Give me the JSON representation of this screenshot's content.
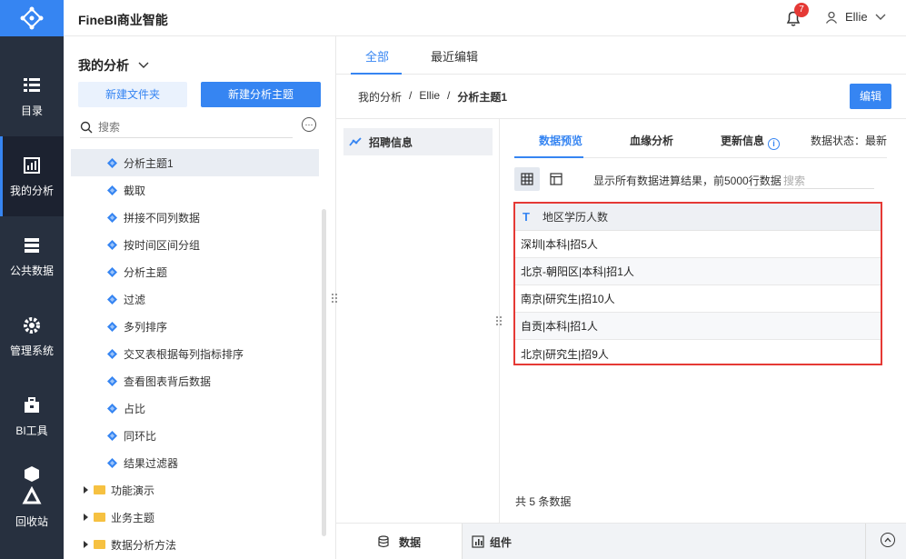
{
  "app": {
    "title": "FineBI商业智能"
  },
  "header": {
    "notification_count": "7",
    "user_name": "Ellie"
  },
  "nav": {
    "items": [
      {
        "label": "目录",
        "icon": "catalog-icon"
      },
      {
        "label": "我的分析",
        "icon": "analysis-icon",
        "active": true
      },
      {
        "label": "公共数据",
        "icon": "database-icon"
      },
      {
        "label": "管理系统",
        "icon": "gear-icon"
      },
      {
        "label": "BI工具",
        "icon": "toolbox-icon"
      },
      {
        "label": "回收站",
        "icon": "recycle-icon"
      }
    ]
  },
  "sidebar": {
    "title": "我的分析",
    "new_folder": "新建文件夹",
    "new_subject": "新建分析主题",
    "search_placeholder": "搜索",
    "items": [
      {
        "label": "分析主题1",
        "active": true
      },
      {
        "label": "截取"
      },
      {
        "label": "拼接不同列数据"
      },
      {
        "label": "按时间区间分组"
      },
      {
        "label": "分析主题"
      },
      {
        "label": "过滤"
      },
      {
        "label": "多列排序"
      },
      {
        "label": "交叉表根据每列指标排序"
      },
      {
        "label": "查看图表背后数据"
      },
      {
        "label": "占比"
      },
      {
        "label": "同环比"
      },
      {
        "label": "结果过滤器"
      }
    ],
    "folders": [
      {
        "label": "功能演示"
      },
      {
        "label": "业务主题"
      },
      {
        "label": "数据分析方法"
      }
    ]
  },
  "main": {
    "tabs": [
      {
        "label": "全部",
        "active": true
      },
      {
        "label": "最近编辑"
      }
    ],
    "breadcrumb": [
      "我的分析",
      "/",
      "Ellie",
      "/",
      "分析主题1"
    ],
    "edit_label": "编辑",
    "dataset": "招聘信息",
    "sub_tabs": [
      {
        "label": "数据预览",
        "active": true
      },
      {
        "label": "血缘分析"
      },
      {
        "label": "更新信息"
      }
    ],
    "status_label": "数据状态：最新",
    "toolbar_text": "显示所有数据进算结果，前5000行数据",
    "toolbar_search": "搜索",
    "table": {
      "header": "地区学历人数",
      "header_icon_glyph": "T",
      "rows": [
        "深圳|本科|招5人",
        "北京-朝阳区|本科|招1人",
        "南京|研究生|招10人",
        "自贡|本科|招1人",
        "北京|研究生|招9人"
      ]
    },
    "row_count": "共 5 条数据",
    "bottom": {
      "data_label": "数据",
      "component_label": "组件"
    }
  },
  "colors": {
    "accent": "#3685f2",
    "nav_bg": "#27303f",
    "highlight_border": "#e53935"
  }
}
